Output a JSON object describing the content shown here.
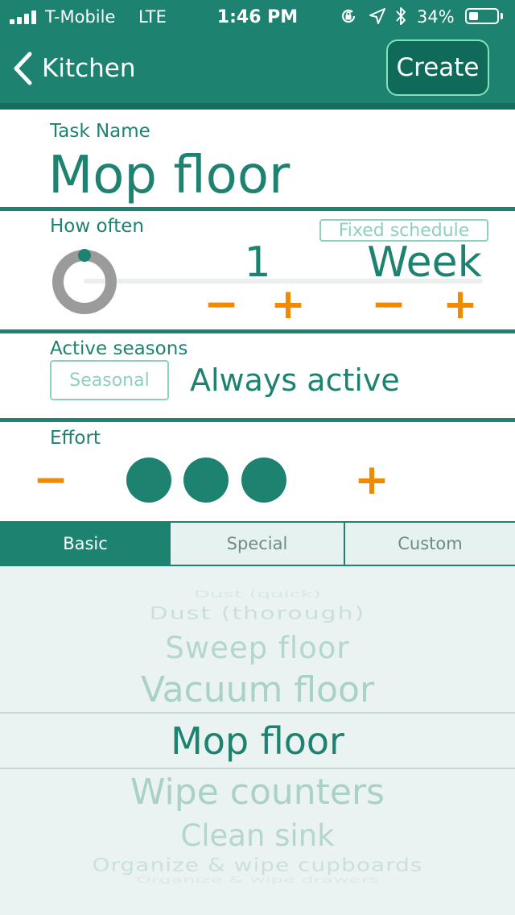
{
  "status_bar": {
    "carrier": "T-Mobile",
    "network": "LTE",
    "time": "1:46 PM",
    "battery": "34%",
    "battery_level": 0.34
  },
  "nav": {
    "back_label": "Kitchen",
    "create_label": "Create"
  },
  "task": {
    "label": "Task Name",
    "value": "Mop floor"
  },
  "frequency": {
    "label": "How often",
    "fixed_schedule_label": "Fixed schedule",
    "count": "1",
    "unit": "Week",
    "minus": "−",
    "plus": "+"
  },
  "seasons": {
    "label": "Active seasons",
    "seasonal_button": "Seasonal",
    "value": "Always active"
  },
  "effort": {
    "label": "Effort",
    "minus": "−",
    "plus": "+",
    "level": 3
  },
  "tabs": [
    {
      "label": "Basic",
      "active": true
    },
    {
      "label": "Special",
      "active": false
    },
    {
      "label": "Custom",
      "active": false
    }
  ],
  "picker": {
    "items": [
      "Dust (quick)",
      "Dust (thorough)",
      "Sweep floor",
      "Vacuum floor",
      "Mop floor",
      "Wipe counters",
      "Clean sink",
      "Organize & wipe cupboards",
      "Organize & wipe drawers"
    ],
    "selected": "Mop floor"
  },
  "colors": {
    "brand": "#1d8270",
    "accent": "#f08a00",
    "create_border": "#7fe3b6"
  }
}
